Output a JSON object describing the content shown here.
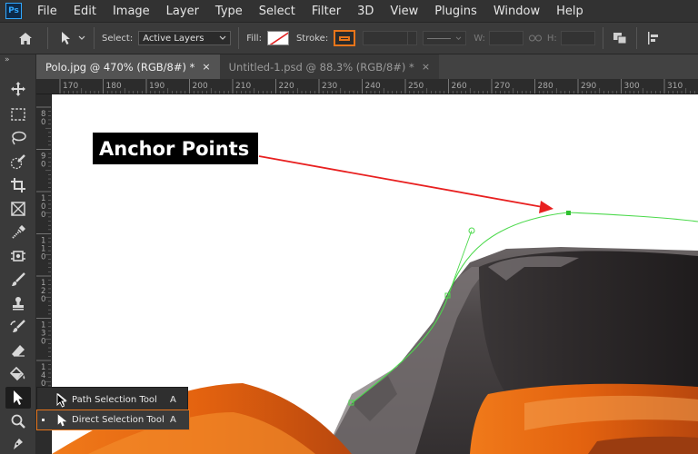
{
  "menubar": {
    "logo": "Ps",
    "items": [
      "File",
      "Edit",
      "Image",
      "Layer",
      "Type",
      "Select",
      "Filter",
      "3D",
      "View",
      "Plugins",
      "Window",
      "Help"
    ]
  },
  "options": {
    "select_label": "Select:",
    "select_value": "Active Layers",
    "fill_label": "Fill:",
    "stroke_label": "Stroke:",
    "w_label": "W:",
    "h_label": "H:"
  },
  "tabs": [
    {
      "label": "Polo.jpg @ 470% (RGB/8#) *",
      "close": "×",
      "active": true
    },
    {
      "label": "Untitled-1.psd @ 88.3% (RGB/8#) *",
      "close": "×",
      "active": false
    }
  ],
  "ruler": {
    "top_labels": [
      "170",
      "180",
      "190",
      "200",
      "210",
      "220",
      "230",
      "240",
      "250",
      "260",
      "270",
      "280",
      "290",
      "300",
      "310"
    ],
    "left_labels": [
      [
        "8",
        "0"
      ],
      [
        "9",
        "0"
      ],
      [
        "1",
        "0",
        "0"
      ],
      [
        "1",
        "1",
        "0"
      ],
      [
        "1",
        "2",
        "0"
      ],
      [
        "1",
        "3",
        "0"
      ],
      [
        "1",
        "4",
        "0"
      ]
    ]
  },
  "callout": {
    "text": "Anchor Points"
  },
  "flyout": {
    "items": [
      {
        "label": "Path Selection Tool",
        "key": "A"
      },
      {
        "label": "Direct Selection Tool",
        "key": "A"
      }
    ]
  },
  "colors": {
    "accent_highlight": "#e8751a",
    "path_green": "#4cd94c",
    "arrow_red": "#e82020"
  },
  "tools": [
    "move-tool-icon",
    "marquee-tool-icon",
    "lasso-tool-icon",
    "quick-selection-tool-icon",
    "crop-tool-icon",
    "frame-tool-icon",
    "eyedropper-tool-icon",
    "healing-brush-tool-icon",
    "brush-tool-icon",
    "clone-stamp-tool-icon",
    "history-brush-tool-icon",
    "eraser-tool-icon",
    "paint-bucket-tool-icon",
    "path-selection-tool-icon",
    "zoom-tool-icon",
    "pen-tool-icon"
  ]
}
